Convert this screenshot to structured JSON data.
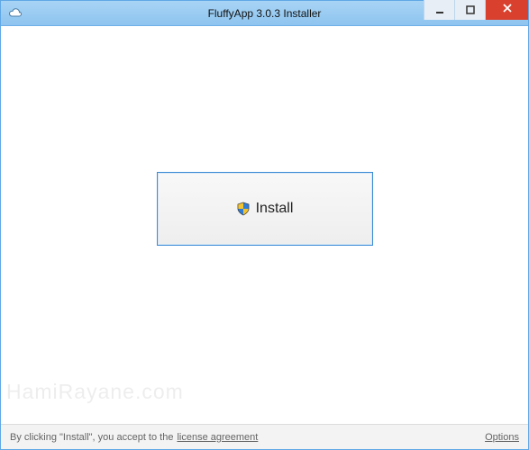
{
  "window": {
    "title": "FluffyApp 3.0.3 Installer"
  },
  "main": {
    "install_label": "Install"
  },
  "footer": {
    "legal_prefix": "By clicking \"Install\", you accept to the",
    "license_link": "license agreement",
    "options_link": "Options"
  },
  "watermark": "HamiRayane.com"
}
